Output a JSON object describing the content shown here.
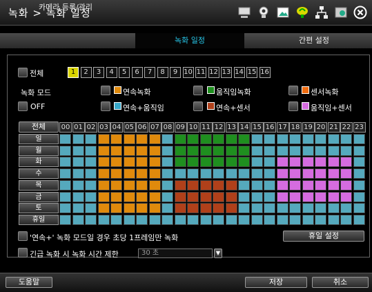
{
  "window": {
    "title": "녹화 > 녹화 일정"
  },
  "tabs": [
    {
      "label": "카메라 등록/관리",
      "active": false
    },
    {
      "label": "녹화 일정",
      "active": true
    },
    {
      "label": "간편 설정",
      "active": false
    }
  ],
  "camera": {
    "all_label": "전체",
    "numbers": [
      "1",
      "2",
      "3",
      "4",
      "5",
      "6",
      "7",
      "8",
      "9",
      "10",
      "11",
      "12",
      "13",
      "14",
      "15",
      "16"
    ],
    "selected": "1"
  },
  "modes": {
    "title": "녹화 모드",
    "off": "OFF",
    "items": [
      {
        "label": "연속녹화",
        "color": "#e08a0c"
      },
      {
        "label": "움직임녹화",
        "color": "#1f8f1f"
      },
      {
        "label": "센서녹화",
        "color": "#f06c10"
      },
      {
        "label": "연속+움직임",
        "color": "#37a7c9"
      },
      {
        "label": "연속+센서",
        "color": "#b0401a"
      },
      {
        "label": "움직임+센서",
        "color": "#d56cdf"
      }
    ]
  },
  "schedule": {
    "all_label": "전체",
    "hours": [
      "00",
      "01",
      "02",
      "03",
      "04",
      "05",
      "06",
      "07",
      "08",
      "09",
      "10",
      "11",
      "12",
      "13",
      "14",
      "15",
      "16",
      "17",
      "18",
      "19",
      "20",
      "21",
      "22",
      "23"
    ],
    "days": [
      "일",
      "월",
      "화",
      "수",
      "목",
      "금",
      "토",
      "휴일"
    ],
    "default_color": "#55a9bd",
    "blocks": [
      {
        "color": "#e08a0c",
        "days": [
          0,
          1,
          2,
          3,
          4,
          5,
          6
        ],
        "hours": [
          3,
          4,
          5,
          6,
          7
        ]
      },
      {
        "color": "#1f8f1f",
        "days": [
          0,
          1,
          2
        ],
        "hours": [
          9,
          10,
          11,
          12,
          13,
          14
        ]
      },
      {
        "color": "#b0401a",
        "days": [
          4,
          5,
          6
        ],
        "hours": [
          9,
          10,
          11,
          12,
          13
        ]
      },
      {
        "color": "#d56cdf",
        "days": [
          2,
          3,
          4,
          5
        ],
        "hours": [
          17,
          18,
          19,
          20,
          21,
          22
        ]
      }
    ]
  },
  "options": {
    "note": "'연속+' 녹화 모드일 경우 초당 1프레임만 녹화",
    "holiday_button": "휴일 설정",
    "emergency_label": "긴급 녹화 시 녹화 시간 제한",
    "emergency_value": "30 초"
  },
  "footer": {
    "help": "도움말",
    "save": "저장",
    "cancel": "취소"
  }
}
